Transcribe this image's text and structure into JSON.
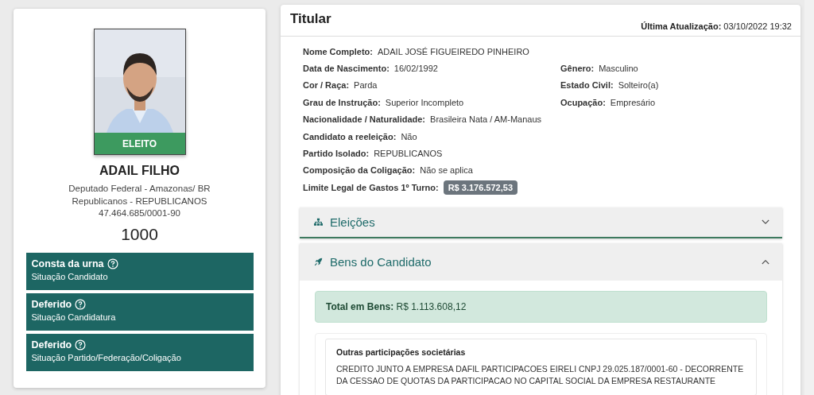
{
  "candidate": {
    "status_badge": "ELEITO",
    "name": "ADAIL FILHO",
    "office": "Deputado Federal - Amazonas/ BR",
    "party": "Republicanos - REPUBLICANOS",
    "cnpj": "47.464.685/0001-90",
    "number": "1000"
  },
  "situations": [
    {
      "value": "Consta da urna",
      "label": "Situação Candidato"
    },
    {
      "value": "Deferido",
      "label": "Situação Candidatura"
    },
    {
      "value": "Deferido",
      "label": "Situação Partido/Federação/Coligação"
    }
  ],
  "titular": {
    "title": "Titular",
    "updated_label": "Última Atualização:",
    "updated_value": "03/10/2022 19:32",
    "rows": [
      {
        "left": {
          "label": "Nome Completo:",
          "value": "ADAIL JOSÉ FIGUEIREDO PINHEIRO",
          "kind": "text"
        }
      },
      {
        "left": {
          "label": "Data de Nascimento:",
          "value": "16/02/1992",
          "kind": "text"
        },
        "right": {
          "label": "Gênero:",
          "value": "Masculino",
          "kind": "text"
        }
      },
      {
        "left": {
          "label": "Cor / Raça:",
          "value": "Parda",
          "kind": "text"
        },
        "right": {
          "label": "Estado Civil:",
          "value": "Solteiro(a)",
          "kind": "text"
        }
      },
      {
        "left": {
          "label": "Grau de Instrução:",
          "value": "Superior Incompleto",
          "kind": "text"
        },
        "right": {
          "label": "Ocupação:",
          "value": "Empresário",
          "kind": "text"
        }
      },
      {
        "left": {
          "label": "Nacionalidade / Naturalidade:",
          "value": "Brasileira Nata / AM-Manaus",
          "kind": "text"
        }
      },
      {
        "left": {
          "label": "Candidato a reeleição:",
          "value": "Não",
          "kind": "text"
        }
      },
      {
        "left": {
          "label": "Partido Isolado:",
          "value": "REPUBLICANOS",
          "kind": "text"
        }
      },
      {
        "left": {
          "label": "Composição da Coligação:",
          "value": "Não se aplica",
          "kind": "text"
        }
      },
      {
        "left": {
          "label": "Limite Legal de Gastos 1º Turno:",
          "value": "R$ 3.176.572,53",
          "kind": "badge"
        }
      }
    ]
  },
  "sections": [
    {
      "title": "Eleições",
      "expanded": false
    },
    {
      "title": "Bens do Candidato",
      "expanded": true,
      "total_label": "Total em Bens:",
      "total_value": "R$ 1.113.608,12",
      "assets": [
        {
          "title": "Outras participações societárias",
          "description": "CREDITO JUNTO A EMPRESA DAFIL PARTICIPACOES EIRELI CNPJ 29.025.187/0001-60 - DECORRENTE DA CESSAO DE QUOTAS DA PARTICIPACAO NO CAPITAL SOCIAL DA EMPRESA RESTAURANTE"
        }
      ]
    }
  ]
}
